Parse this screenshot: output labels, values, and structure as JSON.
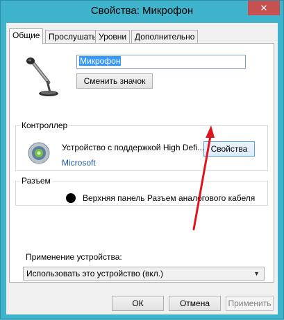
{
  "window": {
    "title": "Свойства: Микрофон",
    "close_glyph": "✕"
  },
  "tabs": [
    {
      "label": "Общие",
      "active": true
    },
    {
      "label": "Прослушать",
      "active": false
    },
    {
      "label": "Уровни",
      "active": false
    },
    {
      "label": "Дополнительно",
      "active": false
    }
  ],
  "general": {
    "device_name": "Микрофон",
    "change_icon_label": "Сменить значок",
    "controller": {
      "group_label": "Контроллер",
      "device_text": "Устройство с поддержкой High Defi...",
      "vendor": "Microsoft",
      "properties_label": "Свойства"
    },
    "connector": {
      "group_label": "Разъем",
      "text": "Верхняя панель Разъем аналогового кабеля"
    },
    "usage": {
      "label": "Применение устройства:",
      "selected": "Использовать это устройство (вкл.)"
    }
  },
  "footer": {
    "ok": "ОК",
    "cancel": "Отмена",
    "apply": "Применить"
  },
  "annotation": {
    "arrow_color": "#e0141e"
  }
}
